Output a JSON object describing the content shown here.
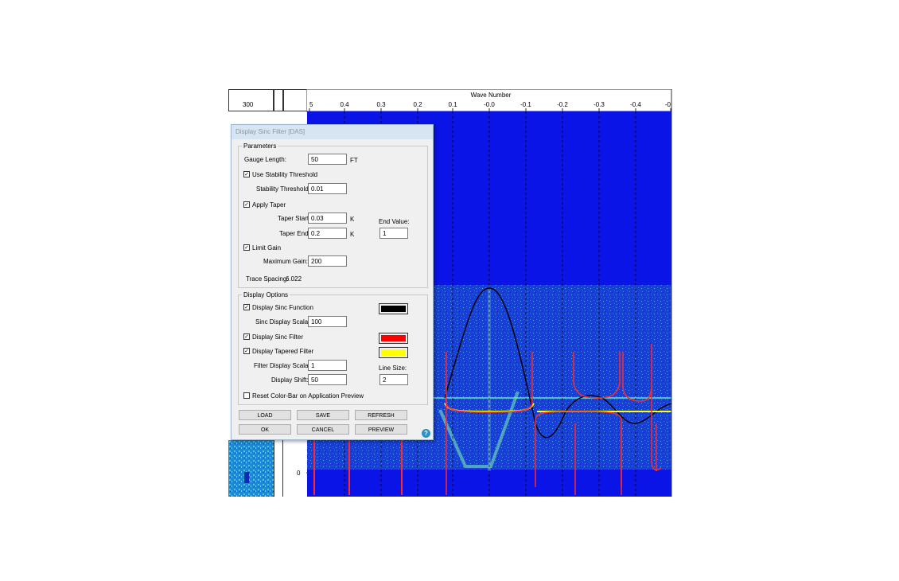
{
  "plot": {
    "axis_title": "Wave Number",
    "left_axis_tick": "300",
    "y_axis_tick": "0",
    "x_ticks": [
      "5",
      "0.4",
      "0.3",
      "0.2",
      "0.1",
      "-0.0",
      "-0.1",
      "-0.2",
      "-0.3",
      "-0.4",
      "-0"
    ]
  },
  "dialog": {
    "title": "Display Sinc Filter [DAS]",
    "parameters": {
      "legend": "Parameters",
      "gauge_length_label": "Gauge Length:",
      "gauge_length_value": "50",
      "gauge_length_unit": "FT",
      "use_stability_label": "Use Stability Threshold",
      "stability_label": "Stability Threshold:",
      "stability_value": "0.01",
      "apply_taper_label": "Apply Taper",
      "taper_start_label": "Taper Start:",
      "taper_start_value": "0.03",
      "taper_start_unit": "K",
      "taper_end_label": "Taper End:",
      "taper_end_value": "0.2",
      "taper_end_unit": "K",
      "end_value_label": "End Value:",
      "end_value": "1",
      "limit_gain_label": "Limit Gain",
      "max_gain_label": "Maximum Gain:",
      "max_gain_value": "200",
      "trace_spacing_label": "Trace Spacing:",
      "trace_spacing_value": "6.022"
    },
    "display": {
      "legend": "Display Options",
      "sinc_function_label": "Display Sinc Function",
      "sinc_scalar_label": "Sinc Display Scalar:",
      "sinc_scalar_value": "100",
      "sinc_filter_label": "Display Sinc Filter",
      "tapered_filter_label": "Display Tapered Filter",
      "filter_scalar_label": "Filter Display Scalar:",
      "filter_scalar_value": "1",
      "line_size_label": "Line Size:",
      "line_size_value": "2",
      "shift_label": "Display Shift:",
      "shift_value": "50",
      "reset_colorbar_label": "Reset Color-Bar on Application Preview"
    },
    "checkmark": "✓",
    "help_glyph": "?",
    "buttons": {
      "load": "LOAD",
      "save": "SAVE",
      "refresh": "REFRESH",
      "ok": "OK",
      "cancel": "CANCEL",
      "preview": "PREVIEW"
    }
  },
  "colors": {
    "spectrum_blue": "#0a14e6",
    "sinc_function": "#000000",
    "sinc_filter": "#ff0000",
    "tapered_filter": "#ffff00"
  }
}
